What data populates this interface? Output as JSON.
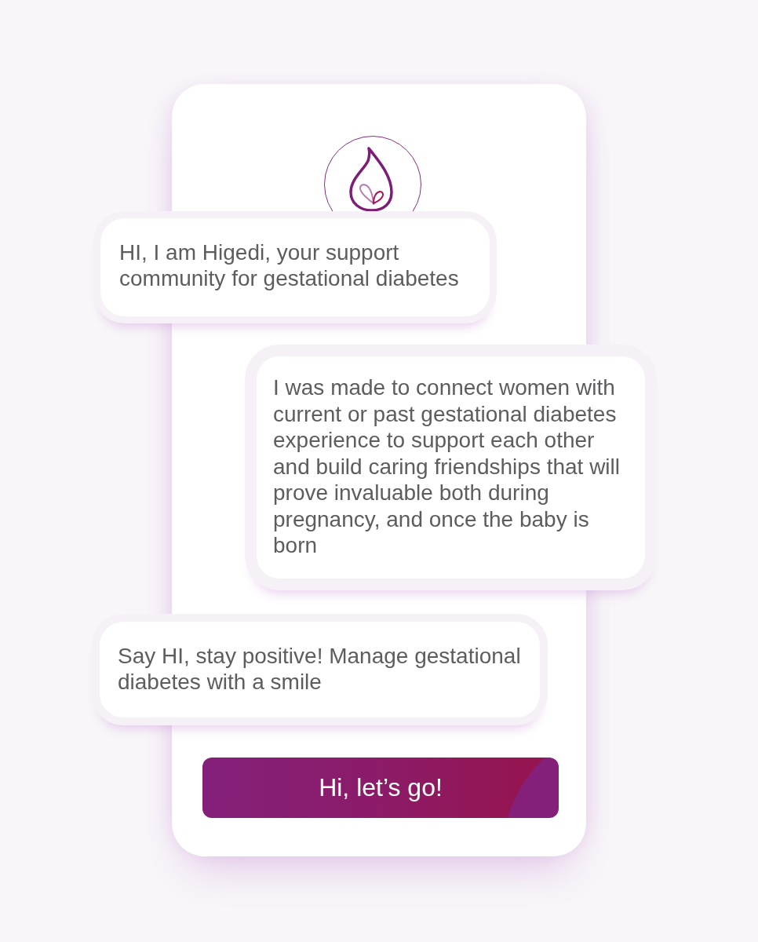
{
  "messages": [
    {
      "text": "HI, I am Higedi, your support community for gestational diabetes"
    },
    {
      "text": "I was made to connect women with current or past gestational diabetes experience to support each other and build caring friendships that will prove invaluable both during pregnancy, and once the baby is born"
    },
    {
      "text": "Say HI, stay positive! Manage gestational diabetes with a smile"
    }
  ],
  "button": {
    "label": "Hi, let’s go!"
  }
}
